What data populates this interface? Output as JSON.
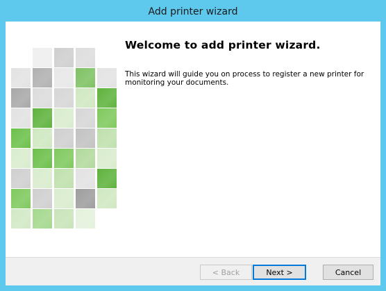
{
  "window": {
    "title": "Add printer wizard"
  },
  "content": {
    "heading": "Welcome to add printer wizard.",
    "description": "This wizard will guide you on process to register a new printer for monitoring your documents."
  },
  "buttons": {
    "back_label": "< Back",
    "next_label": "Next >",
    "cancel_label": "Cancel"
  },
  "colors": {
    "titlebar": "#5ec8ed",
    "accent_green": "#6cc04a",
    "default_button_border": "#0078d7"
  },
  "graphic": {
    "name": "wizard-mosaic-graphic"
  }
}
